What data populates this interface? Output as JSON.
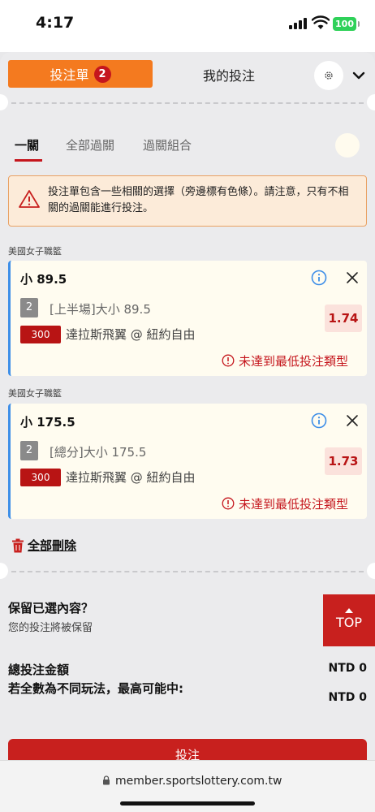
{
  "status_bar": {
    "time": "4:17",
    "battery": "100",
    "battery_color": "#2fd159"
  },
  "tabs": {
    "betslip_label": "投注單",
    "betslip_count": "2",
    "mybets_label": "我的投注"
  },
  "subtabs": [
    "一關",
    "全部過關",
    "過關組合"
  ],
  "warning": {
    "text": "投注單包含一些相關的選擇（旁邊標有色條）。請注意，只有不相關的過關能進行投注。"
  },
  "bets": [
    {
      "league": "美國女子職籃",
      "title": "小 89.5",
      "selection_number": "2",
      "selection": "[上半場]大小 89.5",
      "code": "300",
      "match": "達拉斯飛翼 @ 紐約自由",
      "odds": "1.74",
      "error": "未達到最低投注類型"
    },
    {
      "league": "美國女子職籃",
      "title": "小 175.5",
      "selection_number": "2",
      "selection": "[總分]大小 175.5",
      "code": "300",
      "match": "達拉斯飛翼 @ 紐約自由",
      "odds": "1.73",
      "error": "未達到最低投注類型"
    }
  ],
  "delete_all_label": "全部刪除",
  "keep": {
    "title": "保留已選內容？",
    "subtitle": "您的投注將被保留"
  },
  "top_button_label": "TOP",
  "totals": {
    "total_label": "總投注金額",
    "total_value": "NTD 0",
    "max_win_label": "若全數為不同玩法，最高可能中:",
    "max_win_value": "NTD 0"
  },
  "place_bet_label": "投注",
  "browser": {
    "url": "member.sportslottery.com.tw"
  },
  "colors": {
    "accent_orange": "#f47a1f",
    "brand_red": "#c8201e",
    "link_blue": "#3d8ee8"
  }
}
